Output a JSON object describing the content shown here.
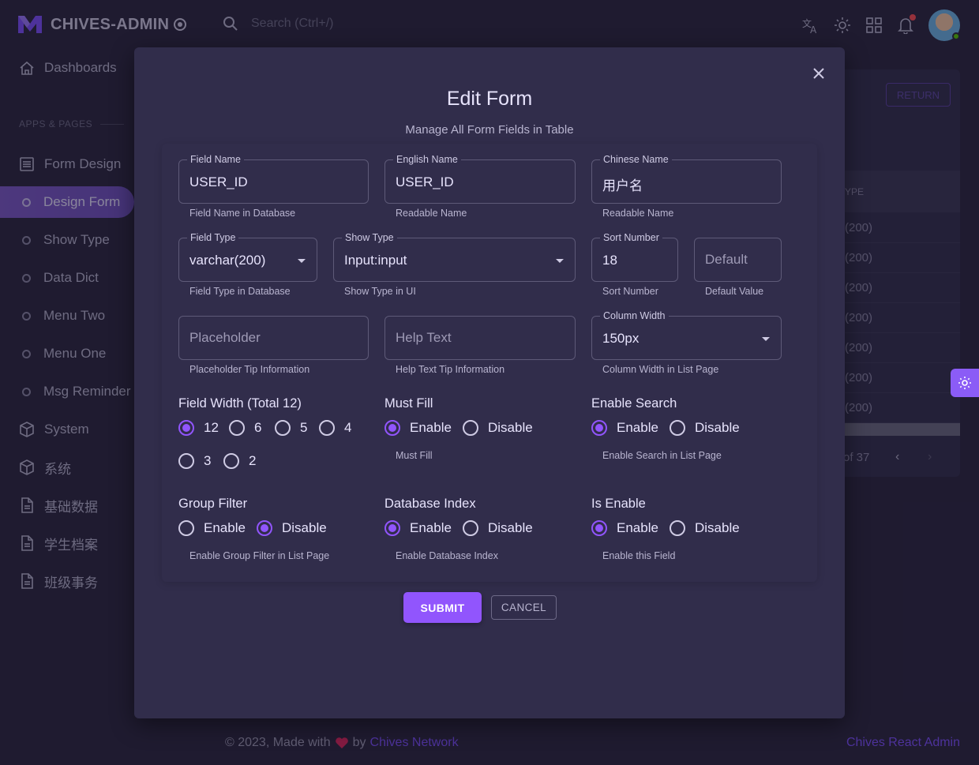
{
  "app": {
    "brand": "CHIVES-ADMIN",
    "search_placeholder": "Search (Ctrl+/)"
  },
  "sidebar": {
    "dashboards": "Dashboards",
    "section": "APPS & PAGES",
    "items": [
      {
        "label": "Form Design",
        "icon": "form-icon"
      },
      {
        "label": "Design Form",
        "icon": "circle-icon",
        "active": true
      },
      {
        "label": "Show Type",
        "icon": "circle-icon"
      },
      {
        "label": "Data Dict",
        "icon": "circle-icon"
      },
      {
        "label": "Menu Two",
        "icon": "circle-icon"
      },
      {
        "label": "Menu One",
        "icon": "circle-icon"
      },
      {
        "label": "Msg Reminder",
        "icon": "circle-icon"
      },
      {
        "label": "System",
        "icon": "cube-icon"
      },
      {
        "label": "系统",
        "icon": "cube-icon"
      },
      {
        "label": "基础数据",
        "icon": "file-icon"
      },
      {
        "label": "学生档案",
        "icon": "file-icon"
      },
      {
        "label": "班级事务",
        "icon": "file-icon"
      }
    ]
  },
  "background": {
    "return_button": "RETURN",
    "column_header": "YPE",
    "rows": [
      "(200)",
      "(200)",
      "(200)",
      "(200)",
      "(200)",
      "(200)",
      "(200)"
    ],
    "pagination": "of 37"
  },
  "modal": {
    "title": "Edit Form",
    "subtitle": "Manage All Form Fields in Table",
    "fields": {
      "field_name": {
        "label": "Field Name",
        "value": "USER_ID",
        "helper": "Field Name in Database"
      },
      "english_name": {
        "label": "English Name",
        "value": "USER_ID",
        "helper": "Readable Name"
      },
      "chinese_name": {
        "label": "Chinese Name",
        "value": "用户名",
        "helper": "Readable Name"
      },
      "field_type": {
        "label": "Field Type",
        "value": "varchar(200)",
        "helper": "Field Type in Database"
      },
      "show_type": {
        "label": "Show Type",
        "value": "Input:input",
        "helper": "Show Type in UI"
      },
      "sort_number": {
        "label": "Sort Number",
        "value": "18",
        "helper": "Sort Number"
      },
      "default_value": {
        "placeholder": "Default",
        "helper": "Default Value"
      },
      "placeholder": {
        "placeholder": "Placeholder",
        "helper": "Placeholder Tip Information"
      },
      "help_text": {
        "placeholder": "Help Text",
        "helper": "Help Text Tip Information"
      },
      "column_width": {
        "label": "Column Width",
        "value": "150px",
        "helper": "Column Width in List Page"
      }
    },
    "field_width": {
      "title": "Field Width (Total 12)",
      "options": [
        "12",
        "6",
        "5",
        "4",
        "3",
        "2"
      ],
      "selected": "12"
    },
    "must_fill": {
      "title": "Must Fill",
      "enable": "Enable",
      "disable": "Disable",
      "selected": "Enable",
      "helper": "Must Fill"
    },
    "enable_search": {
      "title": "Enable Search",
      "enable": "Enable",
      "disable": "Disable",
      "selected": "Enable",
      "helper": "Enable Search in List Page"
    },
    "group_filter": {
      "title": "Group Filter",
      "enable": "Enable",
      "disable": "Disable",
      "selected": "Disable",
      "helper": "Enable Group Filter in List Page"
    },
    "database_index": {
      "title": "Database Index",
      "enable": "Enable",
      "disable": "Disable",
      "selected": "Enable",
      "helper": "Enable Database Index"
    },
    "is_enable": {
      "title": "Is Enable",
      "enable": "Enable",
      "disable": "Disable",
      "selected": "Enable",
      "helper": "Enable this Field"
    },
    "submit": "SUBMIT",
    "cancel": "CANCEL"
  },
  "footer": {
    "prefix": "© 2023, Made with",
    "by": "by",
    "link": "Chives Network",
    "right": "Chives React Admin"
  },
  "colors": {
    "primary": "#9155fd",
    "background": "#28243d",
    "surface": "#312d4b"
  }
}
